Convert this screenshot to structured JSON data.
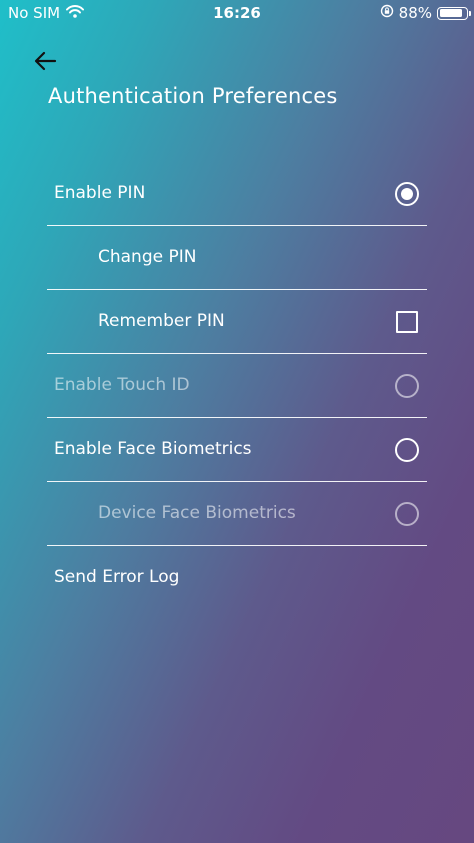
{
  "status_bar": {
    "carrier": "No SIM",
    "time": "16:26",
    "battery_percent": "88%",
    "battery_level": 0.88,
    "icons": [
      "wifi-icon",
      "orientation-lock-icon",
      "battery-icon"
    ]
  },
  "header": {
    "back_icon": "arrow-left-icon",
    "title": "Authentication Preferences"
  },
  "settings": {
    "enable_pin": {
      "label": "Enable PIN",
      "control": "radio",
      "selected": true,
      "enabled": true
    },
    "change_pin": {
      "label": "Change PIN"
    },
    "remember_pin": {
      "label": "Remember PIN",
      "control": "checkbox",
      "checked": false
    },
    "enable_touch_id": {
      "label": "Enable Touch ID",
      "control": "radio",
      "selected": false,
      "enabled": false
    },
    "enable_face_biometrics": {
      "label": "Enable Face Biometrics",
      "control": "radio",
      "selected": false,
      "enabled": true
    },
    "device_face_biometrics": {
      "label": "Device Face Biometrics",
      "control": "radio",
      "selected": false,
      "enabled": false
    },
    "send_error_log": {
      "label": "Send Error Log"
    }
  },
  "colors": {
    "gradient_start": "#1fbfc9",
    "gradient_end": "#664880",
    "text": "#ffffff",
    "disabled_text": "#ffffff8c"
  }
}
